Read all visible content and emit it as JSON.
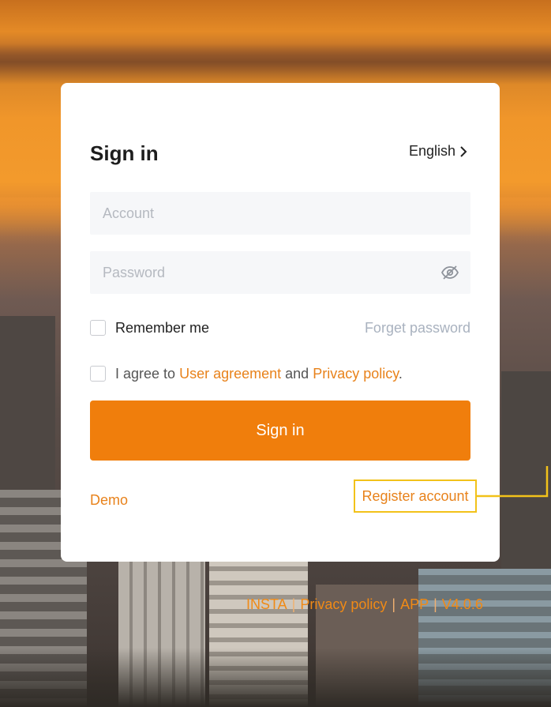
{
  "card": {
    "title": "Sign in",
    "language": "English",
    "account_placeholder": "Account",
    "password_placeholder": "Password",
    "remember_label": "Remember me",
    "forget_password": "Forget password",
    "agree_prefix": "I agree to",
    "user_agreement": "User agreement",
    "agree_and": "and",
    "privacy_policy": "Privacy policy",
    "agree_suffix": ".",
    "signin_button": "Sign in",
    "demo_link": "Demo",
    "register_link": "Register account"
  },
  "footer": {
    "links": [
      "INSTA",
      "Privacy policy",
      "APP",
      "V4.0.6"
    ]
  },
  "icons": {
    "language_chevron": "chevron-right-icon",
    "password_toggle": "eye-slash-icon"
  },
  "colors": {
    "accent": "#f07e0c",
    "link": "#e8821b",
    "highlight_box": "#f2c21a"
  }
}
